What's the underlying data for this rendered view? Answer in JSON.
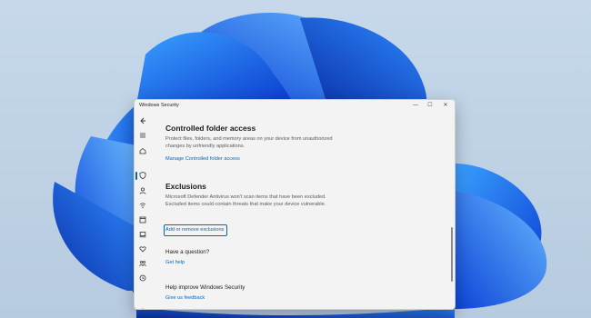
{
  "window": {
    "title": "Windows Security",
    "controls": {
      "minimize": "—",
      "maximize": "☐",
      "close": "✕"
    }
  },
  "nav": {
    "icons": [
      "back-arrow-icon",
      "hamburger-menu-icon",
      "home-icon",
      "shield-icon",
      "person-icon",
      "wifi-icon",
      "app-browser-icon",
      "laptop-icon",
      "heartbeat-icon",
      "family-icon",
      "history-icon",
      "gear-icon"
    ]
  },
  "cfa": {
    "title": "Controlled folder access",
    "desc1": "Protect files, folders, and memory areas on your device from unauthorized",
    "desc2": "changes by unfriendly applications.",
    "link": "Manage Controlled folder access"
  },
  "exclusions": {
    "title": "Exclusions",
    "desc1": "Microsoft Defender Antivirus won't scan items that have been excluded.",
    "desc2": "Excluded items could contain threats that make your device vulnerable.",
    "link": "Add or remove exclusions"
  },
  "question": {
    "title": "Have a question?",
    "link": "Get help"
  },
  "improve": {
    "title": "Help improve Windows Security",
    "link": "Give us feedback"
  },
  "colors": {
    "accent": "#0067c0",
    "window_bg": "#f3f3f3",
    "wallpaper": "#1f5fe0"
  }
}
